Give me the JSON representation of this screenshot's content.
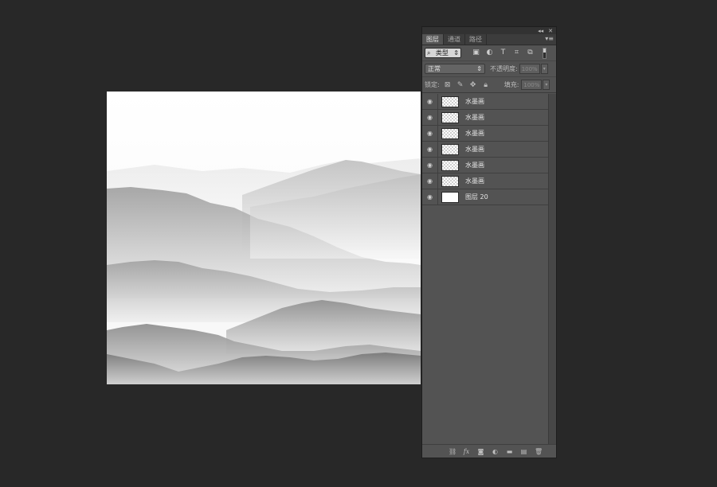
{
  "panel": {
    "tabs": [
      "图层",
      "通道",
      "路径"
    ],
    "active_tab": 0
  },
  "filter": {
    "kind_label": "类型",
    "icons": [
      "image-filter-icon",
      "adjustment-filter-icon",
      "type-filter-icon",
      "shape-filter-icon",
      "smart-object-filter-icon"
    ]
  },
  "blend": {
    "mode": "正常",
    "opacity_label": "不透明度:",
    "opacity_value": "100%"
  },
  "lock": {
    "label": "锁定:",
    "fill_label": "填充:",
    "fill_value": "100%"
  },
  "layers": [
    {
      "name": "水墨画",
      "visible": true,
      "thumb": "transparent"
    },
    {
      "name": "水墨画",
      "visible": true,
      "thumb": "transparent"
    },
    {
      "name": "水墨画",
      "visible": true,
      "thumb": "transparent"
    },
    {
      "name": "水墨画",
      "visible": true,
      "thumb": "transparent"
    },
    {
      "name": "水墨画",
      "visible": true,
      "thumb": "transparent"
    },
    {
      "name": "水墨画",
      "visible": true,
      "thumb": "transparent"
    },
    {
      "name": "图层 20",
      "visible": true,
      "thumb": "white"
    }
  ],
  "footer_icons": [
    "link-layers-icon",
    "fx-icon",
    "add-mask-icon",
    "adjustment-layer-icon",
    "new-group-icon",
    "new-layer-icon",
    "delete-layer-icon"
  ],
  "colors": {
    "workspace": "#282828",
    "panel": "#535353"
  }
}
